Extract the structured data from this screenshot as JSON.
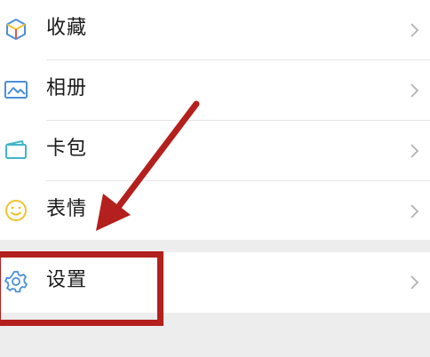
{
  "menu": {
    "items": [
      {
        "label": "收藏",
        "icon": "favorites-cube-icon"
      },
      {
        "label": "相册",
        "icon": "album-picture-icon"
      },
      {
        "label": "卡包",
        "icon": "card-wallet-icon"
      },
      {
        "label": "表情",
        "icon": "smiley-face-icon"
      }
    ],
    "settings": {
      "label": "设置",
      "icon": "gear-icon"
    }
  },
  "annotation": {
    "color": "#b3201d"
  },
  "colors": {
    "background": "#ededed",
    "row_bg": "#ffffff",
    "icon_blue": "#4a90d9",
    "icon_teal": "#3fb6c8",
    "icon_yellow": "#f2c230",
    "chevron": "#b2b2b2"
  }
}
